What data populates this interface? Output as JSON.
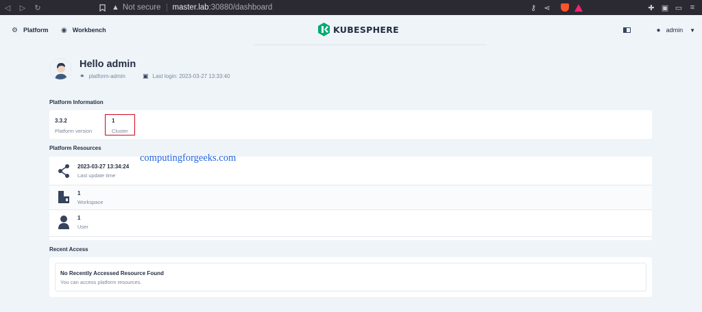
{
  "browser": {
    "security_label": "Not secure",
    "url_host": "master.lab",
    "url_path": ":30880/dashboard"
  },
  "header": {
    "platform_label": "Platform",
    "workbench_label": "Workbench",
    "logo_text": "KUBESPHERE",
    "user_name": "admin"
  },
  "welcome": {
    "greeting": "Hello admin",
    "role": "platform-admin",
    "last_login": "Last login: 2023-03-27 13:33:40"
  },
  "platform_information": {
    "title": "Platform Information",
    "items": [
      {
        "value": "3.3.2",
        "label": "Platform version"
      },
      {
        "value": "1",
        "label": "Cluster"
      }
    ]
  },
  "platform_resources": {
    "title": "Platform Resources",
    "items": [
      {
        "value": "2023-03-27 13:34:24",
        "label": "Last update time",
        "icon": "share-icon"
      },
      {
        "value": "1",
        "label": "Workspace",
        "icon": "workspace-icon"
      },
      {
        "value": "1",
        "label": "User",
        "icon": "user-icon"
      }
    ]
  },
  "watermark": "computingforgeeks.com",
  "recent_access": {
    "title": "Recent Access",
    "empty_title": "No Recently Accessed Resource Found",
    "empty_sub": "You can access platform resources."
  },
  "colors": {
    "brand_green": "#00aa72",
    "highlight_red": "#d0021b",
    "page_bg": "#eff4f9"
  }
}
